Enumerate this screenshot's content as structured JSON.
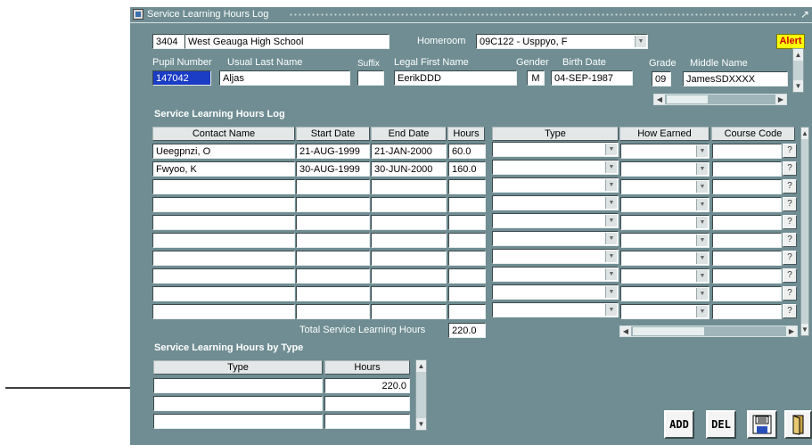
{
  "window": {
    "title": "Service Learning Hours Log"
  },
  "header": {
    "school_code": "3404",
    "school_name": "West Geauga High School",
    "homeroom_label": "Homeroom",
    "homeroom_value": "09C122 - Usppyo, F",
    "alert_label": "Alert"
  },
  "student": {
    "labels": {
      "pupil_number": "Pupil Number",
      "last_name": "Usual Last Name",
      "suffix": "Suffix",
      "first_name": "Legal First Name",
      "gender": "Gender",
      "birth_date": "Birth Date",
      "grade": "Grade",
      "middle_name": "Middle Name"
    },
    "pupil_number": "147042",
    "last_name": "Aljas",
    "suffix": "",
    "first_name": "EerikDDD",
    "gender": "M",
    "birth_date": "04-SEP-1987",
    "grade": "09",
    "middle_name": "JamesSDXXXX"
  },
  "log": {
    "section_title": "Service Learning Hours Log",
    "columns": [
      "Contact Name",
      "Start Date",
      "End Date",
      "Hours",
      "Type",
      "How Earned",
      "Course Code"
    ],
    "rows": [
      {
        "contact": "Ueegpnzi, O",
        "start": "21-AUG-1999",
        "end": "21-JAN-2000",
        "hours": "60.0"
      },
      {
        "contact": "Fwyoo, K",
        "start": "30-AUG-1999",
        "end": "30-JUN-2000",
        "hours": "160.0"
      }
    ],
    "total_label": "Total Service Learning Hours",
    "total_value": "220.0",
    "qbtn_glyph": "?"
  },
  "by_type": {
    "section_title": "Service Learning Hours by Type",
    "columns": [
      "Type",
      "Hours"
    ],
    "rows": [
      {
        "type": "",
        "hours": "220.0"
      }
    ]
  },
  "toolbar": {
    "add_label": "ADD",
    "del_label": "DEL"
  },
  "annotation": {
    "arrow_color": "#000000"
  }
}
